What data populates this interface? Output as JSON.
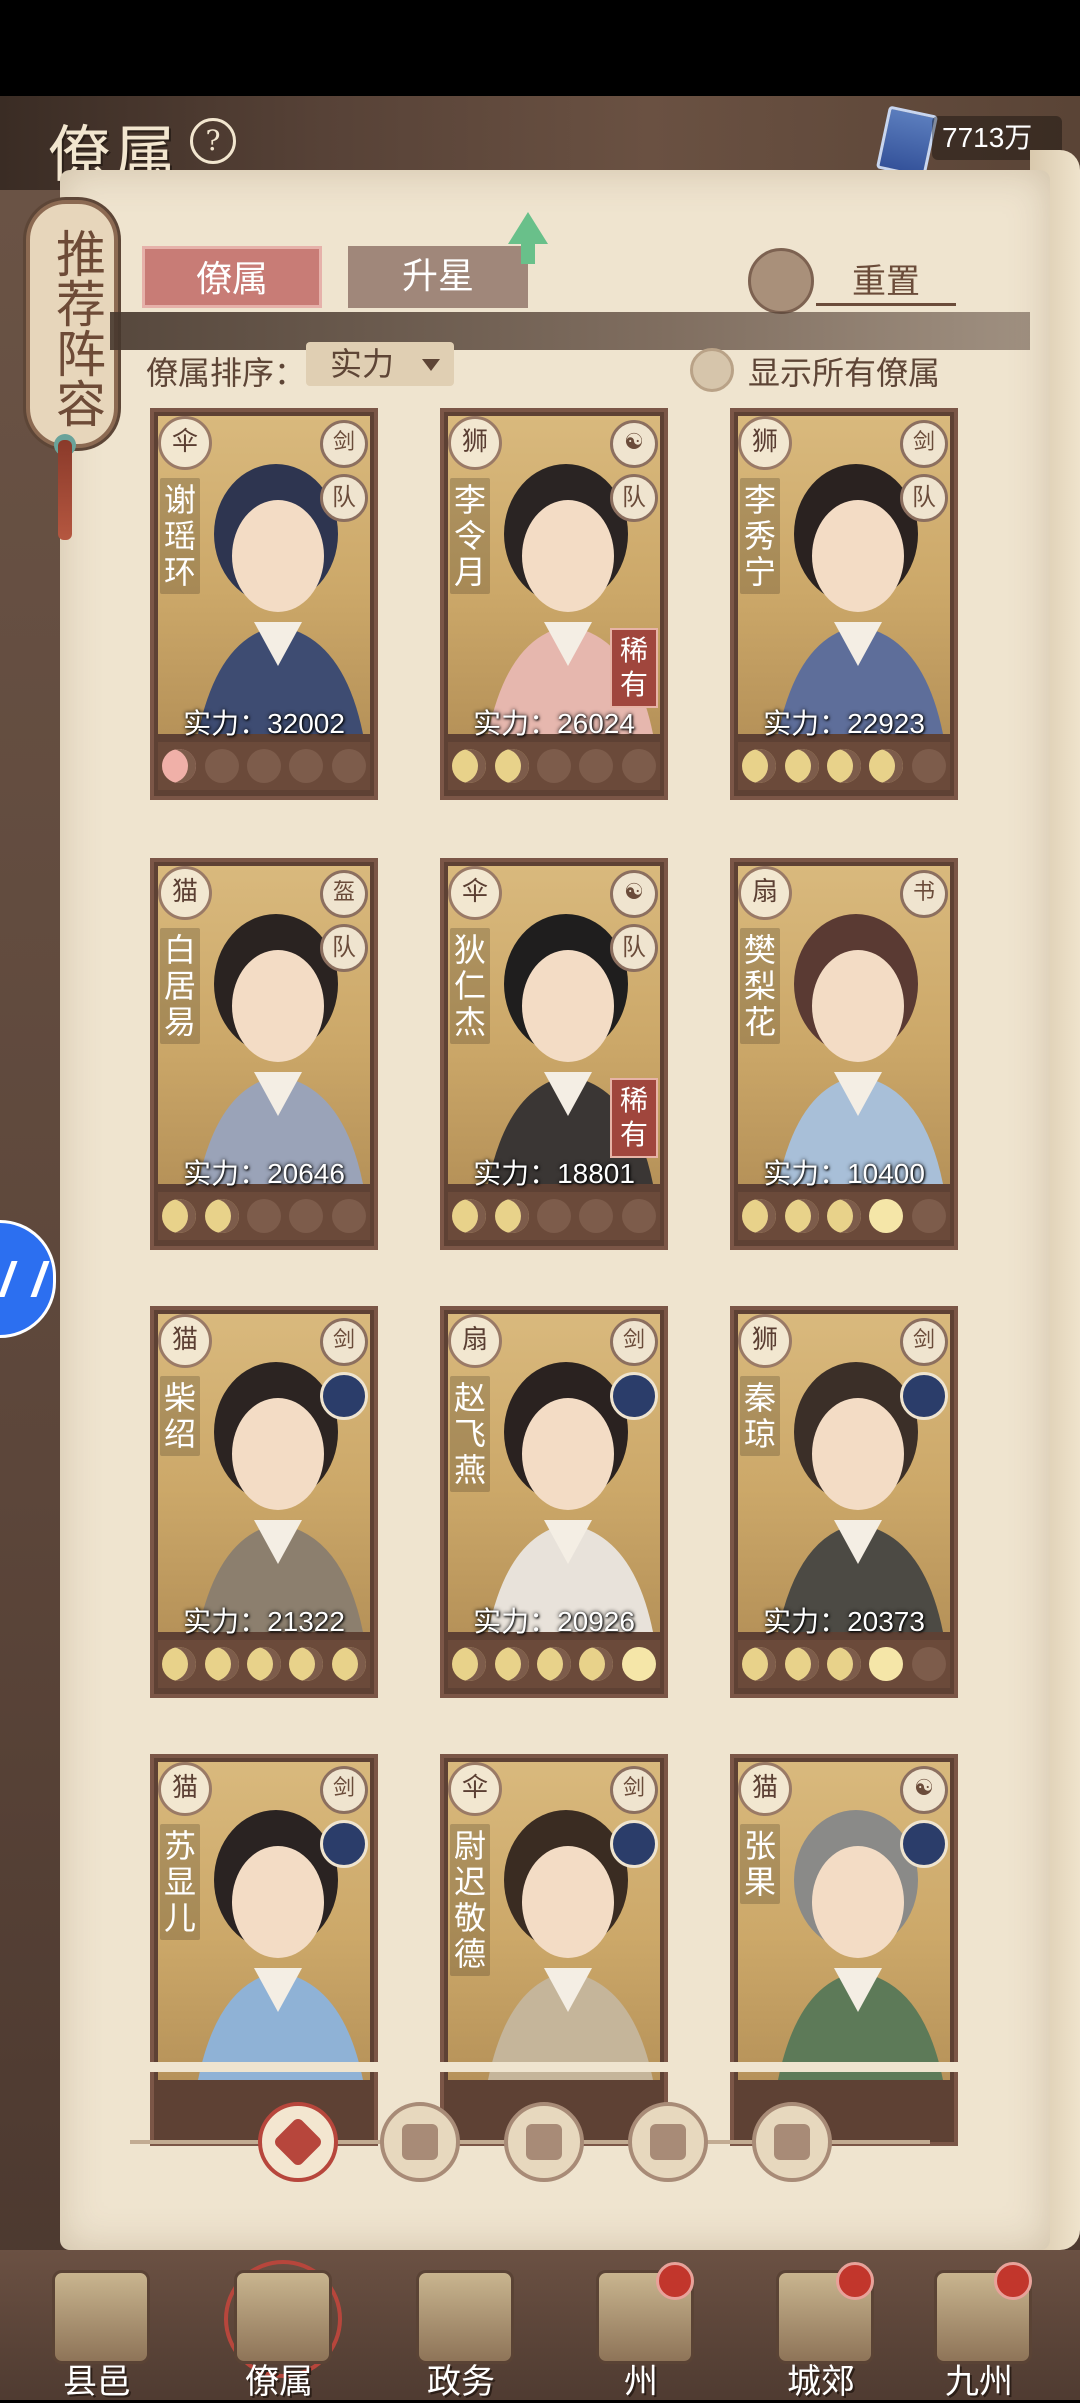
{
  "header": {
    "title": "僚属",
    "help_label": "?",
    "currency_value": "7713万"
  },
  "recommend_tag": "推荐阵容",
  "tabs": [
    {
      "label": "僚属",
      "active": true
    },
    {
      "label": "升星",
      "active": false
    }
  ],
  "reset_label": "重置",
  "sort": {
    "label": "僚属排序：",
    "selected": "实力"
  },
  "show_all_label": "显示所有僚属",
  "cards": [
    {
      "name": "谢瑶环",
      "power": "实力：32002",
      "rarity": "",
      "faction_icon": "伞",
      "role_icon": "剑",
      "team_icon": "队",
      "stars": [
        "pink",
        0,
        0,
        0,
        0
      ]
    },
    {
      "name": "李令月",
      "power": "实力：26024",
      "rarity": "稀有",
      "faction_icon": "狮",
      "role_icon": "☯",
      "team_icon": "队",
      "stars": [
        "on",
        "on",
        0,
        0,
        0
      ]
    },
    {
      "name": "李秀宁",
      "power": "实力：22923",
      "rarity": "",
      "faction_icon": "狮",
      "role_icon": "剑",
      "team_icon": "队",
      "stars": [
        "on",
        "on",
        "on",
        "on",
        0
      ]
    },
    {
      "name": "白居易",
      "power": "实力：20646",
      "rarity": "",
      "faction_icon": "猫",
      "role_icon": "盔",
      "team_icon": "队",
      "stars": [
        "on",
        "on",
        0,
        0,
        0
      ]
    },
    {
      "name": "狄仁杰",
      "power": "实力：18801",
      "rarity": "稀有",
      "faction_icon": "伞",
      "role_icon": "☯",
      "team_icon": "队",
      "stars": [
        "on",
        "on",
        0,
        0,
        0
      ]
    },
    {
      "name": "樊梨花",
      "power": "实力：10400",
      "rarity": "",
      "faction_icon": "扇",
      "role_icon": "书",
      "team_icon": "",
      "stars": [
        "on",
        "on",
        "on",
        "full",
        0
      ]
    },
    {
      "name": "柴绍",
      "power": "实力：21322",
      "rarity": "",
      "faction_icon": "猫",
      "role_icon": "剑",
      "team_icon": "",
      "stars": [
        "on",
        "on",
        "on",
        "on",
        "on"
      ]
    },
    {
      "name": "赵飞燕",
      "power": "实力：20926",
      "rarity": "",
      "faction_icon": "扇",
      "role_icon": "剑",
      "team_icon": "",
      "stars": [
        "on",
        "on",
        "on",
        "on",
        "full"
      ]
    },
    {
      "name": "秦琼",
      "power": "实力：20373",
      "rarity": "",
      "faction_icon": "狮",
      "role_icon": "剑",
      "team_icon": "",
      "stars": [
        "on",
        "on",
        "on",
        "full",
        0
      ]
    },
    {
      "name": "苏显儿",
      "power": "",
      "rarity": "",
      "faction_icon": "猫",
      "role_icon": "剑",
      "team_icon": "",
      "stars": []
    },
    {
      "name": "尉迟敬德",
      "power": "",
      "rarity": "",
      "faction_icon": "伞",
      "role_icon": "剑",
      "team_icon": "",
      "stars": []
    },
    {
      "name": "张果",
      "power": "",
      "rarity": "",
      "faction_icon": "猫",
      "role_icon": "☯",
      "team_icon": "",
      "stars": []
    }
  ],
  "filters": [
    {
      "icon": "all-filter-icon",
      "active": true
    },
    {
      "icon": "umbrella-filter-icon",
      "active": false
    },
    {
      "icon": "cat-filter-icon",
      "active": false
    },
    {
      "icon": "fan-filter-icon",
      "active": false
    },
    {
      "icon": "lion-filter-icon",
      "active": false
    }
  ],
  "bottom_nav": [
    {
      "label": "县邑",
      "badge": false
    },
    {
      "label": "僚属",
      "badge": false,
      "active": true
    },
    {
      "label": "政务",
      "badge": false
    },
    {
      "label": "州",
      "badge": true
    },
    {
      "label": "城郊",
      "badge": true
    },
    {
      "label": "九州",
      "badge": true
    }
  ]
}
